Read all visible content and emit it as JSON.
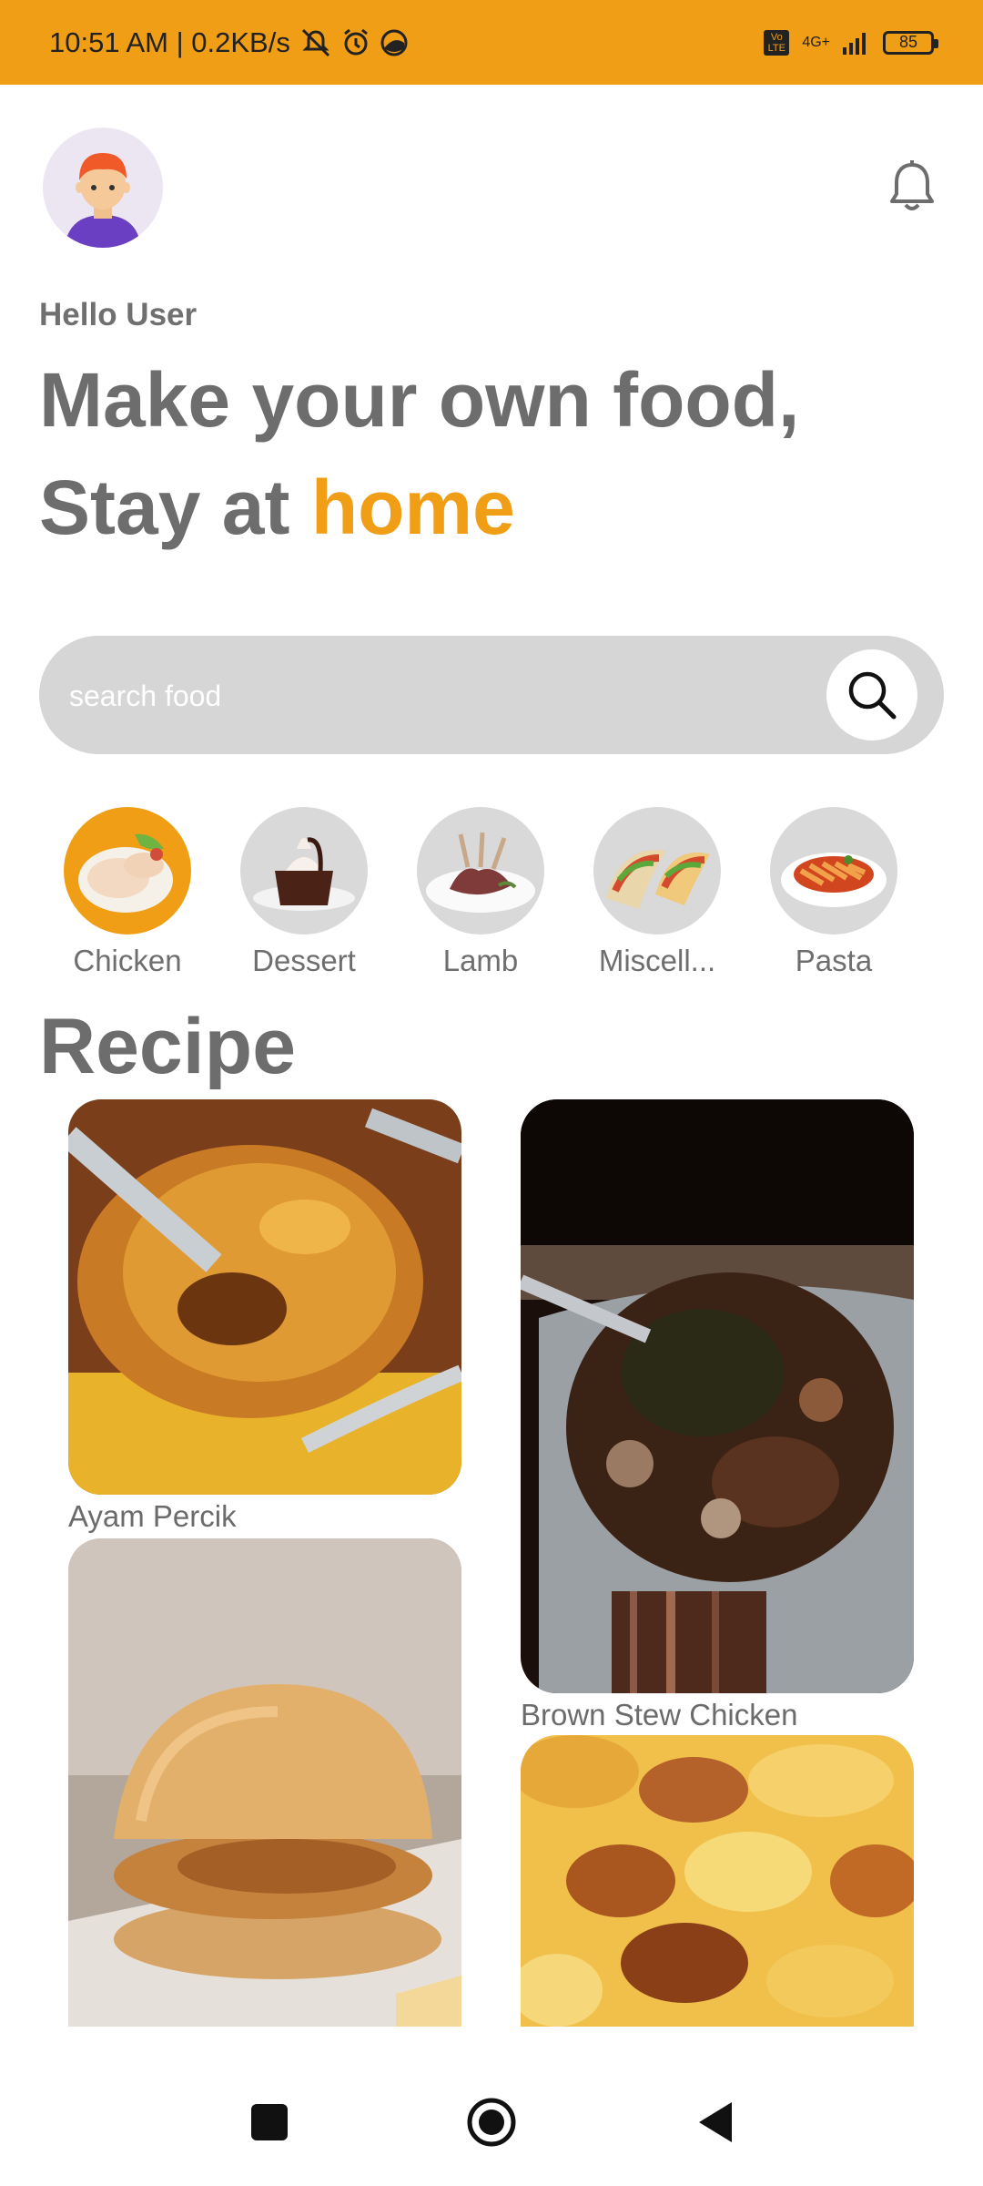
{
  "status_bar": {
    "time_speed": "10:51 AM | 0.2KB/s",
    "network_label": "4G+",
    "volte": "Vo LTE",
    "battery": "85"
  },
  "header": {
    "greeting": "Hello User",
    "headline_line1": "Make your own food,",
    "headline_line2_prefix": "Stay at ",
    "headline_line2_accent": "home"
  },
  "search": {
    "placeholder": "search food"
  },
  "categories": [
    {
      "label": "Chicken",
      "active": true
    },
    {
      "label": "Dessert",
      "active": false
    },
    {
      "label": "Lamb",
      "active": false
    },
    {
      "label": "Miscell...",
      "active": false
    },
    {
      "label": "Pasta",
      "active": false
    }
  ],
  "recipes_title": "Recipe",
  "recipes": [
    {
      "name": "Ayam Percik"
    },
    {
      "name": "Brown Stew Chicken"
    },
    {
      "name": ""
    },
    {
      "name": ""
    }
  ],
  "colors": {
    "accent": "#f09e16",
    "text_gray": "#6d6d6d",
    "chip_gray": "#d9d9d9"
  },
  "icons": {
    "bell": "bell-icon",
    "search": "search-icon",
    "nav_recents": "square-icon",
    "nav_home": "circle-icon",
    "nav_back": "triangle-back-icon"
  }
}
